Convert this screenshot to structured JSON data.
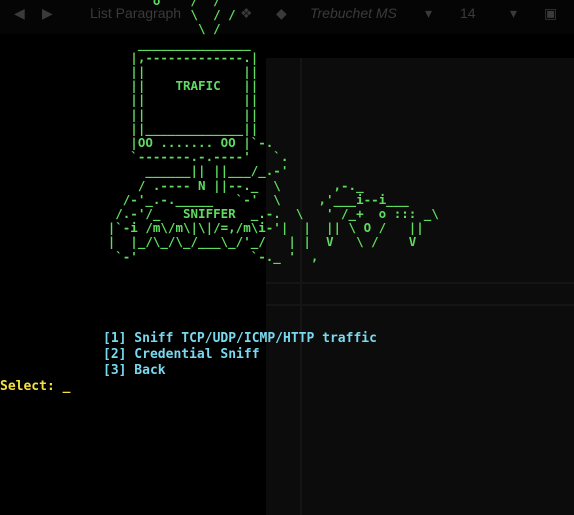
{
  "toolbar": {
    "paragraph_style": "List Paragraph",
    "font_name": "Trebuchet MS",
    "font_size": "14"
  },
  "art": {
    "lines": [
      "               o    /  /",
      "                    \\  / /",
      "                     \\ /",
      "             _______________",
      "            |,-------------.|",
      "            ||             ||",
      "            ||    TRAFIC   ||",
      "            ||             ||",
      "            ||             ||",
      "            ||_____________||",
      "            |OO ....... OO |`-.",
      "            `-------.-.----'   `.",
      "              ______|| ||___/_.-'",
      "             / .---- N ||--._  \\       ,-._",
      "           /-'_.-._____   `-'  \\     ,'___i--i___",
      "          /.-'/_   SNIFFER  _.-.  \\   ' /_+  o ::: _\\",
      "         |`-i /m\\/m\\|\\|/=,/m\\i-'|  |  || \\ O /   ||",
      "         |  |_/\\_/\\_/___\\_/'_/   | |  V   \\ /    V",
      "          `-'               `-._ '  ,"
    ]
  },
  "menu": {
    "item1": "[1] Sniff TCP/UDP/ICMP/HTTP traffic",
    "item2": "[2] Credential Sniff",
    "item3": "[3] Back"
  },
  "prompt": {
    "label": "Select: ",
    "cursor": "_"
  },
  "colors": {
    "art": "#5fdc5f",
    "menu": "#79d9ef",
    "prompt": "#f5e043",
    "background": "#000000"
  }
}
